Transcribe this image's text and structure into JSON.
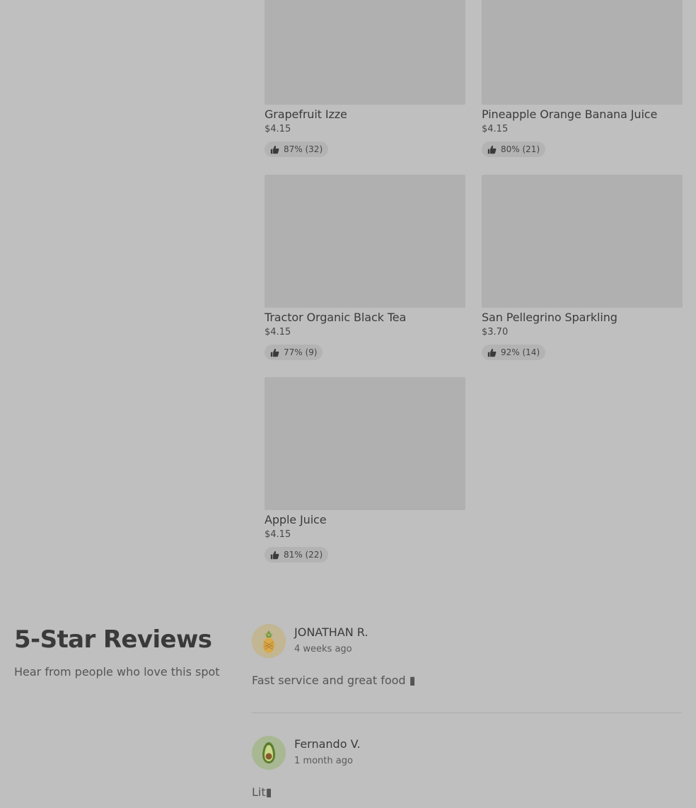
{
  "menu": {
    "items": [
      {
        "name": "Grapefruit Izze",
        "price": "$4.15",
        "rating": "87% (32)"
      },
      {
        "name": "Pineapple Orange Banana Juice",
        "price": "$4.15",
        "rating": "80% (21)"
      },
      {
        "name": "Tractor Organic Black Tea",
        "price": "$4.15",
        "rating": "77% (9)"
      },
      {
        "name": "San Pellegrino Sparkling",
        "price": "$3.70",
        "rating": "92% (14)"
      },
      {
        "name": "Apple Juice",
        "price": "$4.15",
        "rating": "81% (22)"
      }
    ]
  },
  "reviews_section": {
    "title": "5-Star Reviews",
    "subtitle": "Hear from people who love this spot",
    "reviews": [
      {
        "author": "JONATHAN R.",
        "time": "4 weeks ago",
        "text": "Fast service and great food ▮",
        "avatar_icon": "pineapple-icon"
      },
      {
        "author": "Fernando V.",
        "time": "1 month ago",
        "text": "Lit▮",
        "avatar_icon": "avocado-icon"
      }
    ]
  },
  "icons": {
    "rating": "thumbs-up-icon"
  },
  "colors": {
    "overlay": "#bfbfbf",
    "image_placeholder": "#b0b0b0",
    "badge_bg": "#b3b3b3"
  }
}
